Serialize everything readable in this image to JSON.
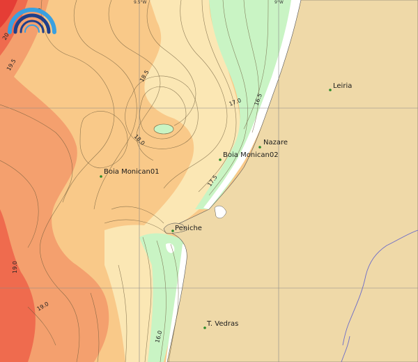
{
  "grid_labels": {
    "lon_left": "9.5°W",
    "lon_right": "9°W"
  },
  "places": [
    {
      "id": "leiria",
      "name": "Leiria"
    },
    {
      "id": "nazare",
      "name": "Nazare"
    },
    {
      "id": "boia2",
      "name": "Boia Monican02"
    },
    {
      "id": "boia1",
      "name": "Boia Monican01"
    },
    {
      "id": "peniche",
      "name": "Peniche"
    },
    {
      "id": "tvedras",
      "name": "T. Vedras"
    }
  ],
  "contour_labels": [
    "19.5",
    "18.5",
    "17.0",
    "16.5",
    "18.0",
    "17.5",
    "19.0",
    "19.0",
    "16.0"
  ],
  "partial_labels": [
    "20",
    "0"
  ],
  "colors": {
    "land": "#efd9a8",
    "sea_cold": "#c9f4c4",
    "sea_cool": "#fbe7b4",
    "sea_mid": "#f9c989",
    "sea_warm": "#f4a06e",
    "sea_hot": "#ef6b4e",
    "sea_hottest": "#e53d35",
    "coast_white": "#ffffff",
    "rivers": "#6b6bc9",
    "town_dot": "#2a8a2a"
  }
}
